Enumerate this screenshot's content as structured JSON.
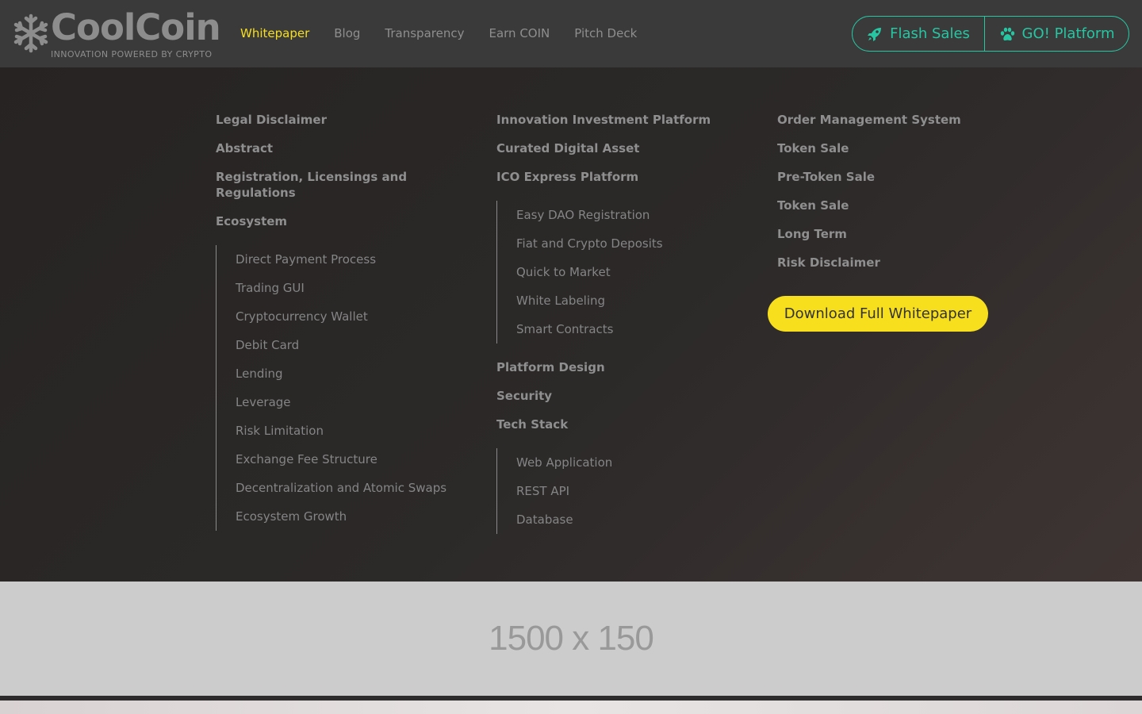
{
  "header": {
    "logo_text": "CoolCoin",
    "tagline": "INNOVATION POWERED BY CRYPTO",
    "nav": [
      {
        "label": "Whitepaper"
      },
      {
        "label": "Blog"
      },
      {
        "label": "Transparency"
      },
      {
        "label": "Earn COIN"
      },
      {
        "label": "Pitch Deck"
      }
    ],
    "active_nav": "Whitepaper",
    "flash_sales_label": "Flash Sales",
    "go_platform_label": "GO! Platform",
    "accent_color": "#26c6a2",
    "highlight_color": "#f7df1e"
  },
  "toc": {
    "col1": {
      "legal": "Legal Disclaimer",
      "abstract": "Abstract",
      "registration": "Registration, Licensings and Regulations",
      "ecosystem": "Ecosystem",
      "ecosystem_items": [
        "Direct Payment Process",
        "Trading GUI",
        "Cryptocurrency Wallet",
        "Debit Card",
        "Lending",
        "Leverage",
        "Risk Limitation",
        "Exchange Fee Structure",
        "Decentralization and Atomic Swaps",
        "Ecosystem Growth"
      ]
    },
    "col2": {
      "innovation": "Innovation Investment Platform",
      "curated": "Curated Digital Asset",
      "ico": "ICO Express Platform",
      "ico_items": [
        "Easy DAO Registration",
        "Fiat and Crypto Deposits",
        "Quick to Market",
        "White Labeling",
        "Smart Contracts"
      ],
      "platform_design": "Platform Design",
      "security": "Security",
      "tech_stack": "Tech Stack",
      "tech_items": [
        "Web Application",
        "REST API",
        "Database"
      ]
    },
    "col3": {
      "items": [
        "Order Management System",
        "Token Sale",
        "Pre-Token Sale",
        "Token Sale",
        "Long Term",
        "Risk Disclaimer"
      ],
      "download_label": "Download Full Whitepaper"
    }
  },
  "banner": {
    "placeholder_text": "1500 x 150"
  }
}
